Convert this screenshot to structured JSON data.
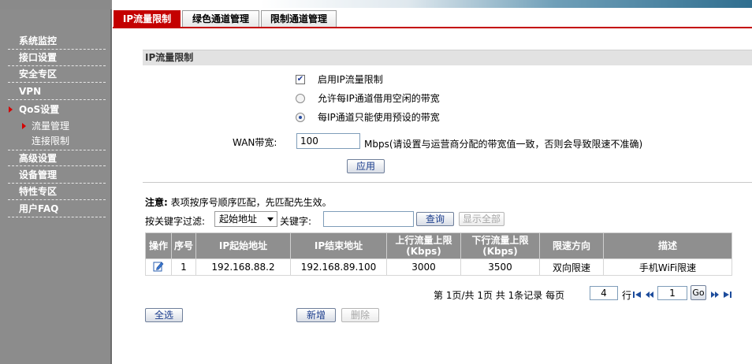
{
  "sidebar": {
    "items": [
      {
        "label": "系统监控"
      },
      {
        "label": "接口设置"
      },
      {
        "label": "安全专区"
      },
      {
        "label": "VPN"
      },
      {
        "label": "QoS设置"
      },
      {
        "label": "高级设置"
      },
      {
        "label": "设备管理"
      },
      {
        "label": "特性专区"
      },
      {
        "label": "用户FAQ"
      }
    ],
    "sub_items": [
      {
        "label": "流量管理"
      },
      {
        "label": "连接限制"
      }
    ]
  },
  "tabs": [
    {
      "label": "IP流量限制"
    },
    {
      "label": "绿色通道管理"
    },
    {
      "label": "限制通道管理"
    }
  ],
  "panel": {
    "title": "IP流量限制",
    "enable_label": "启用IP流量限制",
    "enable_checked": true,
    "radio1_label": "允许每IP通道借用空闲的带宽",
    "radio2_label": "每IP通道只能使用预设的带宽",
    "wan_label": "WAN带宽:",
    "wan_value": "100",
    "wan_hint": "Mbps(请设置与运营商分配的带宽值一致，否则会导致限速不准确)",
    "apply_label": "应用"
  },
  "note": {
    "prefix": "注意:",
    "text": "表项按序号顺序匹配，先匹配先生效。"
  },
  "filter": {
    "label": "按关键字过滤:",
    "select_value": "起始地址",
    "keyword_label": "关键字:",
    "keyword_value": "",
    "search_label": "查询",
    "show_all_label": "显示全部"
  },
  "table": {
    "headers": [
      "操作",
      "序号",
      "IP起始地址",
      "IP结束地址",
      "上行流量上限\n(Kbps)",
      "下行流量上限\n(Kbps)",
      "限速方向",
      "描述"
    ],
    "rows": [
      {
        "index": "1",
        "ip_start": "192.168.88.2",
        "ip_end": "192.168.89.100",
        "up": "3000",
        "down": "3500",
        "direction": "双向限速",
        "desc": "手机WiFi限速"
      }
    ]
  },
  "pager": {
    "page_prefix": "第",
    "current_page": "1",
    "page_mid": "页/共",
    "total_pages": "1",
    "page_suffix": "页 共",
    "total_records": "1",
    "records_suffix": "条记录 每页",
    "per_page": "4",
    "per_page_suffix": "行",
    "goto_value": "1",
    "go_label": "Go"
  },
  "actions": {
    "select_all_label": "全选",
    "add_label": "新增",
    "delete_label": "删除"
  },
  "colors": {
    "accent": "#c40000",
    "sidebar": "#8c8c8c",
    "table_header": "#8f8f8f"
  }
}
